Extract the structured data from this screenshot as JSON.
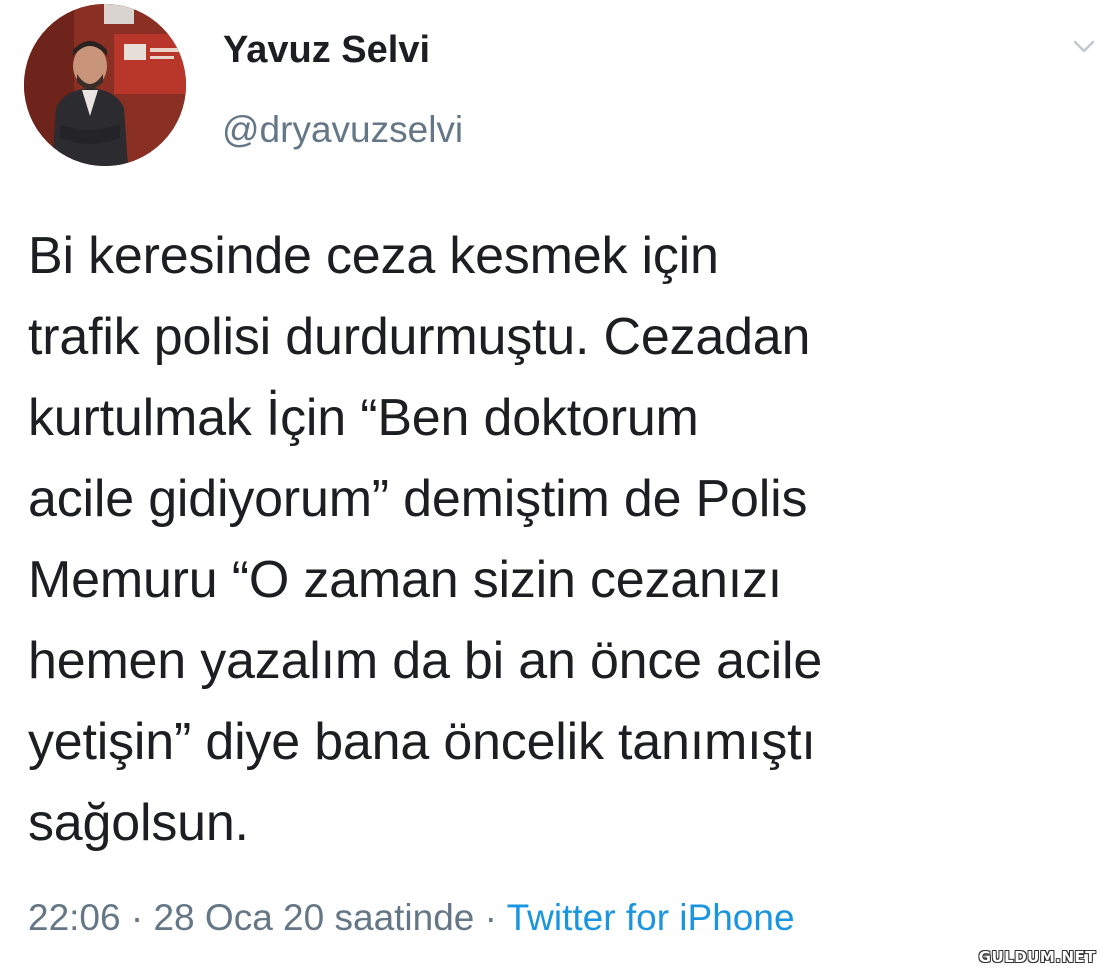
{
  "colors": {
    "name": "#1c1e21",
    "secondary": "#657786",
    "link": "#1b95e0"
  },
  "tweet": {
    "author_name": "Yavuz Selvi",
    "author_handle": "@dryavuzselvi",
    "text": "Bi keresinde ceza kesmek için\ntrafik polisi durdurmuştu. Cezadan\nkurtulmak İçin “Ben doktorum\nacile gidiyorum” demiştim de Polis\nMemuru “O zaman sizin cezanızı\nhemen yazalım da bi an önce acile\nyetişin” diye bana öncelik tanımıştı\nsağolsun.",
    "time": "22:06",
    "separator": " · ",
    "date": "28 Oca 20 saatinde",
    "source": "Twitter for iPhone"
  },
  "icons": {
    "avatar": "avatar-photo",
    "menu": "chevron-down-icon"
  },
  "watermark": "GULDUM.NET"
}
